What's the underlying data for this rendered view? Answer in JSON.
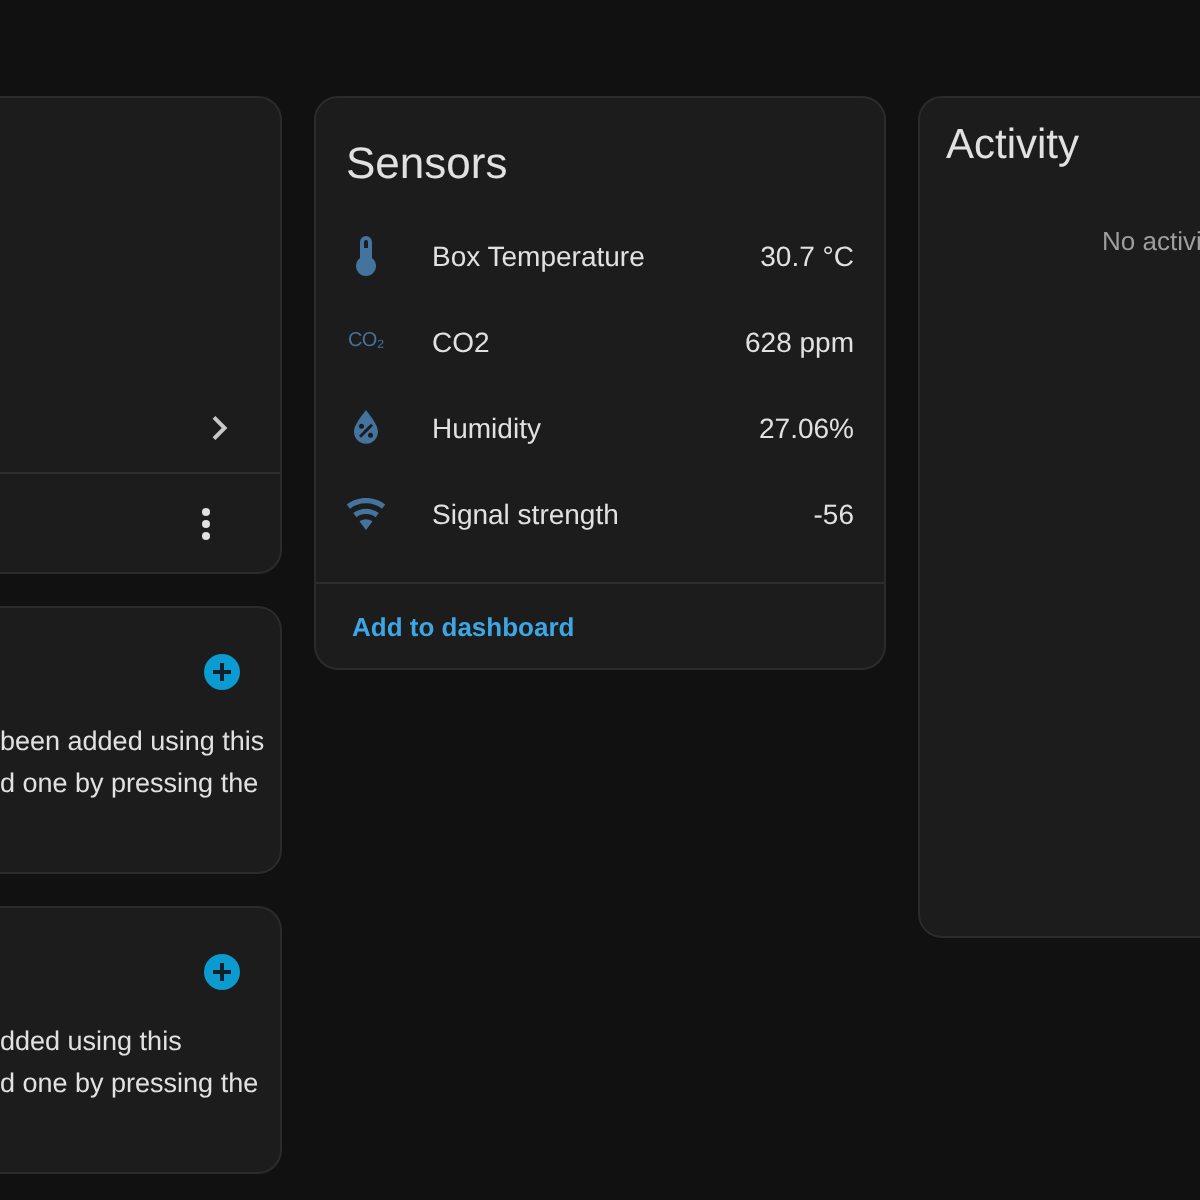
{
  "left_cards": [
    {
      "kind": "device"
    },
    {
      "kind": "empty_list",
      "lines": [
        "been added using this",
        "d one by pressing the"
      ]
    },
    {
      "kind": "empty_list",
      "lines": [
        "dded using this",
        "d one by pressing the"
      ]
    }
  ],
  "sensors": {
    "title": "Sensors",
    "rows": [
      {
        "kind": "temperature",
        "name": "Box Temperature",
        "value": "30.7 °C"
      },
      {
        "kind": "co2",
        "symbol": "CO₂",
        "name": "CO2",
        "value": "628 ppm"
      },
      {
        "kind": "humidity",
        "name": "Humidity",
        "value": "27.06%"
      },
      {
        "kind": "signal",
        "name": "Signal strength",
        "value": "-56"
      }
    ],
    "action": "Add to dashboard"
  },
  "activity": {
    "title": "Activity",
    "empty_text": "No activi"
  }
}
